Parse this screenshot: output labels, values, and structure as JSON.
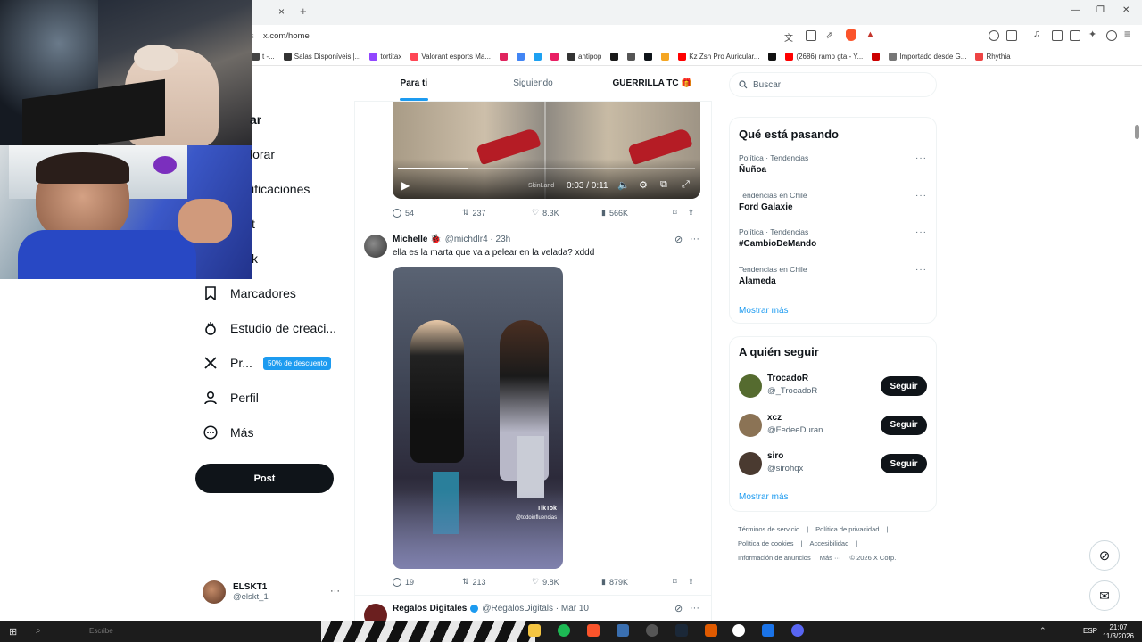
{
  "browser": {
    "url": "x.com/home",
    "url_fragment": "s",
    "new_tab": "+",
    "close_tab": "×",
    "bookmarks": [
      {
        "label": "t -...",
        "color": "#444"
      },
      {
        "label": "Salas Disponíveis |...",
        "color": "#333"
      },
      {
        "label": "tortitax",
        "color": "#9146ff"
      },
      {
        "label": "Valorant esports Ma...",
        "color": "#ff4655"
      },
      {
        "label": "",
        "color": "#e0245e"
      },
      {
        "label": "",
        "color": "#4285f4"
      },
      {
        "label": "",
        "color": "#1da1f2"
      },
      {
        "label": "",
        "color": "#e91e63"
      },
      {
        "label": "antipop",
        "color": "#333"
      },
      {
        "label": "",
        "color": "#1a1a1a"
      },
      {
        "label": "",
        "color": "#555"
      },
      {
        "label": "",
        "color": "#0f1419"
      },
      {
        "label": "",
        "color": "#f5a623"
      },
      {
        "label": "Kz Zsn Pro Auricular...",
        "color": "#ff0000"
      },
      {
        "label": "",
        "color": "#111"
      },
      {
        "label": "(2686) ramp gta - Y...",
        "color": "#ff0000"
      },
      {
        "label": "",
        "color": "#c00"
      },
      {
        "label": "Importado desde G...",
        "color": "#777"
      },
      {
        "label": "Rhythia",
        "color": "#e44"
      }
    ]
  },
  "nav": {
    "items": [
      {
        "label": "ar"
      },
      {
        "label": "lorar"
      },
      {
        "label": "ificaciones"
      },
      {
        "label": "t"
      },
      {
        "label": "k"
      },
      {
        "label": "Marcadores"
      },
      {
        "label": "Estudio de creaci..."
      },
      {
        "label": "Pr..."
      },
      {
        "label": "Perfil"
      },
      {
        "label": "Más"
      }
    ],
    "promo_badge": "50% de descuento",
    "post_button": "Post",
    "account": {
      "name": "ELSKT1",
      "handle": "@elskt_1",
      "more": "···"
    }
  },
  "timeline": {
    "tabs": [
      {
        "label": "Para ti",
        "active": true
      },
      {
        "label": "Siguiendo",
        "active": false
      },
      {
        "label": "GUERRILLA TC 🎁",
        "active": false
      }
    ],
    "video": {
      "time": "0:03 / 0:11",
      "watermark": "SkinLand"
    },
    "tweet1_actions": {
      "replies": "54",
      "reposts": "237",
      "likes": "8.3K",
      "views": "566K"
    },
    "tweet2": {
      "name": "Michelle 🐞",
      "handle": "@michdlr4 · 23h",
      "text": "ella es la marta que va a pelear en la velada? xddd",
      "actions": {
        "replies": "19",
        "reposts": "213",
        "likes": "9.8K",
        "views": "879K"
      },
      "tiktok_label": "TikTok",
      "tiktok_handle": "@todoinfluencias"
    },
    "tweet3": {
      "name": "Regalos Digitales",
      "handle": "@RegalosDigitals · Mar 10"
    }
  },
  "right": {
    "search_placeholder": "Buscar",
    "trends_title": "Qué está pasando",
    "trends": [
      {
        "meta": "Política · Tendencias",
        "name": "Ñuñoa"
      },
      {
        "meta": "Tendencias en Chile",
        "name": "Ford Galaxie"
      },
      {
        "meta": "Política · Tendencias",
        "name": "#CambioDeMando"
      },
      {
        "meta": "Tendencias en Chile",
        "name": "Alameda"
      }
    ],
    "show_more": "Mostrar más",
    "who_title": "A quién seguir",
    "who": [
      {
        "name": "TrocadoR",
        "handle": "@_TrocadoR",
        "button": "Seguir",
        "color": "#556b2f"
      },
      {
        "name": "xcz",
        "handle": "@FedeeDuran",
        "button": "Seguir",
        "color": "#8b7355"
      },
      {
        "name": "siro",
        "handle": "@sirohqx",
        "button": "Seguir",
        "color": "#4a3a30"
      }
    ],
    "footer": {
      "line1": [
        "Términos de servicio",
        "|",
        "Política de privacidad",
        "|"
      ],
      "line2": [
        "Política de cookies",
        "|",
        "Accesibilidad",
        "|"
      ],
      "line3": [
        "Información de anuncios",
        "Más ···",
        "© 2026 X Corp."
      ]
    }
  },
  "taskbar": {
    "search": "Escribe",
    "lang": "ESP",
    "time": "21:07",
    "date": "11/3/2026"
  }
}
